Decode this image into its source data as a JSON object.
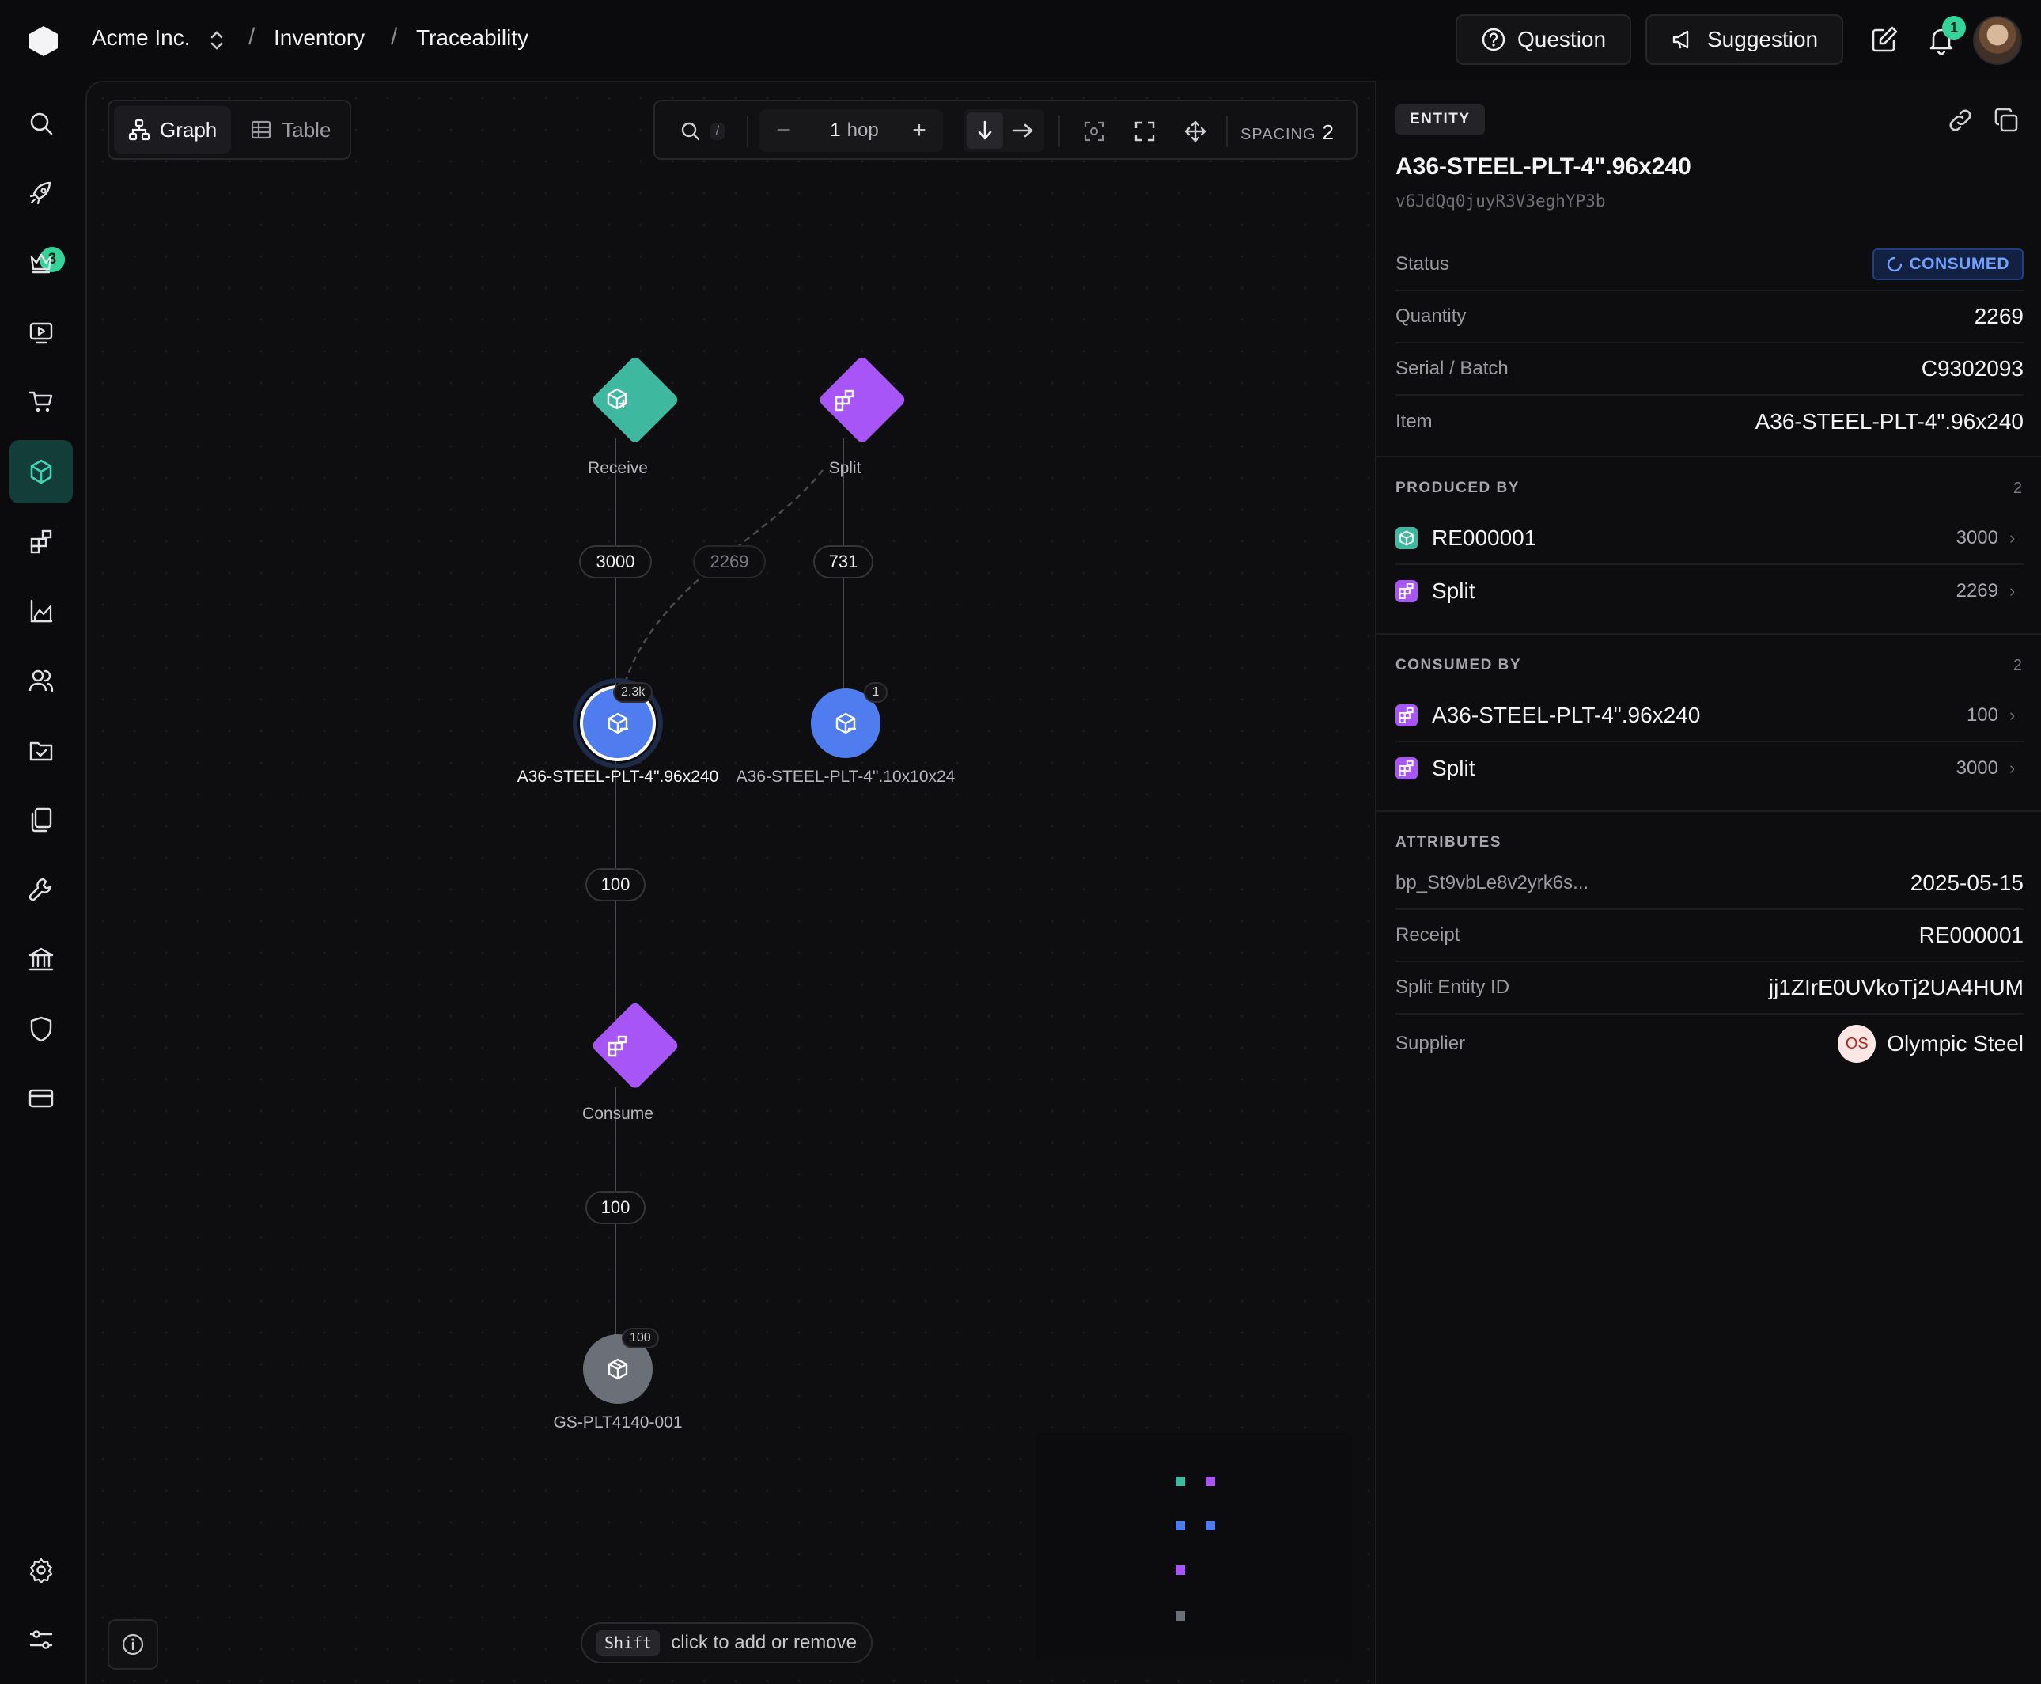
{
  "breadcrumb": {
    "org": "Acme Inc.",
    "section": "Inventory",
    "page": "Traceability",
    "sep": "/"
  },
  "topbar": {
    "question_label": "Question",
    "suggestion_label": "Suggestion",
    "notification_count": "1"
  },
  "sidebar": {
    "items": [
      "search-icon",
      "rocket-icon",
      "crown-icon",
      "video-icon",
      "cart-icon",
      "cube-icon",
      "blocks-icon",
      "chart-icon",
      "users-icon",
      "folder-check-icon",
      "files-icon",
      "wrench-icon",
      "bank-icon",
      "shield-icon",
      "credit-card-icon",
      "settings-icon",
      "sliders-icon"
    ],
    "active": "cube-icon",
    "rocket_badge": "3"
  },
  "canvas": {
    "view_toggle": {
      "graph_label": "Graph",
      "table_label": "Table",
      "active": "Graph"
    },
    "toolbar": {
      "search_shortcut": "/",
      "hop_value": "1",
      "hop_unit": "hop",
      "spacing_label": "SPACING",
      "spacing_value": "2",
      "direction": "down"
    },
    "nodes": {
      "receive": {
        "label": "Receive",
        "color": "#3fb8a0"
      },
      "split": {
        "label": "Split",
        "color": "#a855f7"
      },
      "entity_main": {
        "label": "A36-STEEL-PLT-4\".96x240",
        "badge": "2.3k",
        "color": "#4f7df0"
      },
      "entity_other": {
        "label": "A36-STEEL-PLT-4\".10x10x24",
        "badge": "1",
        "color": "#4f7df0"
      },
      "consume": {
        "label": "Consume",
        "color": "#a855f7"
      },
      "output": {
        "label": "GS-PLT4140-001",
        "badge": "100",
        "color": "#6b6f78"
      }
    },
    "edges": {
      "receive_to_main": "3000",
      "split_to_main": "2269",
      "split_to_other": "731",
      "main_to_consume": "100",
      "consume_to_output": "100"
    },
    "hint": {
      "key": "Shift",
      "text": "click to add or remove"
    }
  },
  "panel": {
    "badge": "ENTITY",
    "title": "A36-STEEL-PLT-4\".96x240",
    "id": "v6JdQq0juyR3V3eghYP3b",
    "fields": {
      "status_key": "Status",
      "status_value": "CONSUMED",
      "quantity_key": "Quantity",
      "quantity_value": "2269",
      "serial_key": "Serial / Batch",
      "serial_value": "C9302093",
      "item_key": "Item",
      "item_value": "A36-STEEL-PLT-4\".96x240"
    },
    "produced_by": {
      "title": "PRODUCED BY",
      "count": "2",
      "items": [
        {
          "name": "RE000001",
          "qty": "3000",
          "icon": "receive-icon",
          "color": "#3fb8a0"
        },
        {
          "name": "Split",
          "qty": "2269",
          "icon": "split-icon",
          "color": "#a855f7"
        }
      ]
    },
    "consumed_by": {
      "title": "CONSUMED BY",
      "count": "2",
      "items": [
        {
          "name": "A36-STEEL-PLT-4\".96x240",
          "qty": "100",
          "icon": "split-icon",
          "color": "#a855f7"
        },
        {
          "name": "Split",
          "qty": "3000",
          "icon": "split-icon",
          "color": "#a855f7"
        }
      ]
    },
    "attributes": {
      "title": "ATTRIBUTES",
      "rows": [
        {
          "key": "bp_St9vbLe8v2yrk6s...",
          "value": "2025-05-15"
        },
        {
          "key": "Receipt",
          "value": "RE000001"
        },
        {
          "key": "Split Entity ID",
          "value": "jj1ZIrE0UVkoTj2UA4HUM"
        }
      ],
      "supplier_key": "Supplier",
      "supplier_initials": "OS",
      "supplier_value": "Olympic Steel"
    }
  }
}
